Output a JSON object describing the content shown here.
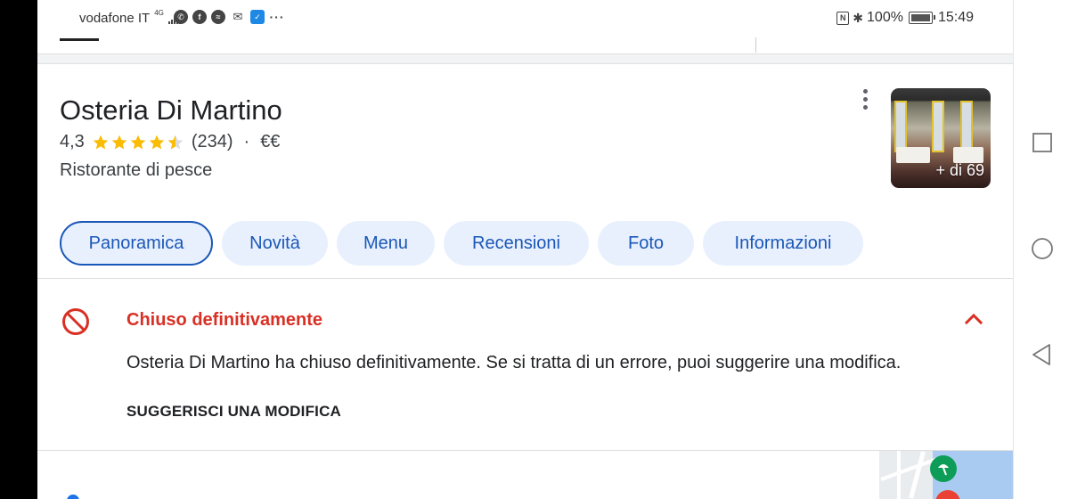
{
  "status_bar": {
    "carrier": "vodafone IT",
    "network_type": "4G",
    "battery": "100%",
    "time": "15:49",
    "app_icons": [
      "whatsapp-icon",
      "facebook-icon",
      "messenger-icon",
      "gmail-icon",
      "app-icon",
      "more-notifications-icon"
    ]
  },
  "place": {
    "name": "Osteria Di Martino",
    "rating": "4,3",
    "rating_value": 4.3,
    "reviews_count": "(234)",
    "separator": "·",
    "price_level": "€€",
    "category": "Ristorante di pesce",
    "photo_count_label": "+ di 69"
  },
  "tabs": [
    {
      "label": "Panoramica",
      "active": true
    },
    {
      "label": "Novità",
      "active": false
    },
    {
      "label": "Menu",
      "active": false
    },
    {
      "label": "Recensioni",
      "active": false
    },
    {
      "label": "Foto",
      "active": false
    },
    {
      "label": "Informazioni",
      "active": false
    }
  ],
  "closed_notice": {
    "title": "Chiuso definitivamente",
    "description": "Osteria Di Martino ha chiuso definitivamente. Se si tratta di un errore, puoi suggerire una modifica.",
    "action": "SUGGERISCI UNA MODIFICA"
  },
  "colors": {
    "accent_blue": "#1a57b7",
    "chip_bg": "#e8f0fe",
    "closed_red": "#d93025",
    "star_gold": "#fbbc04"
  }
}
